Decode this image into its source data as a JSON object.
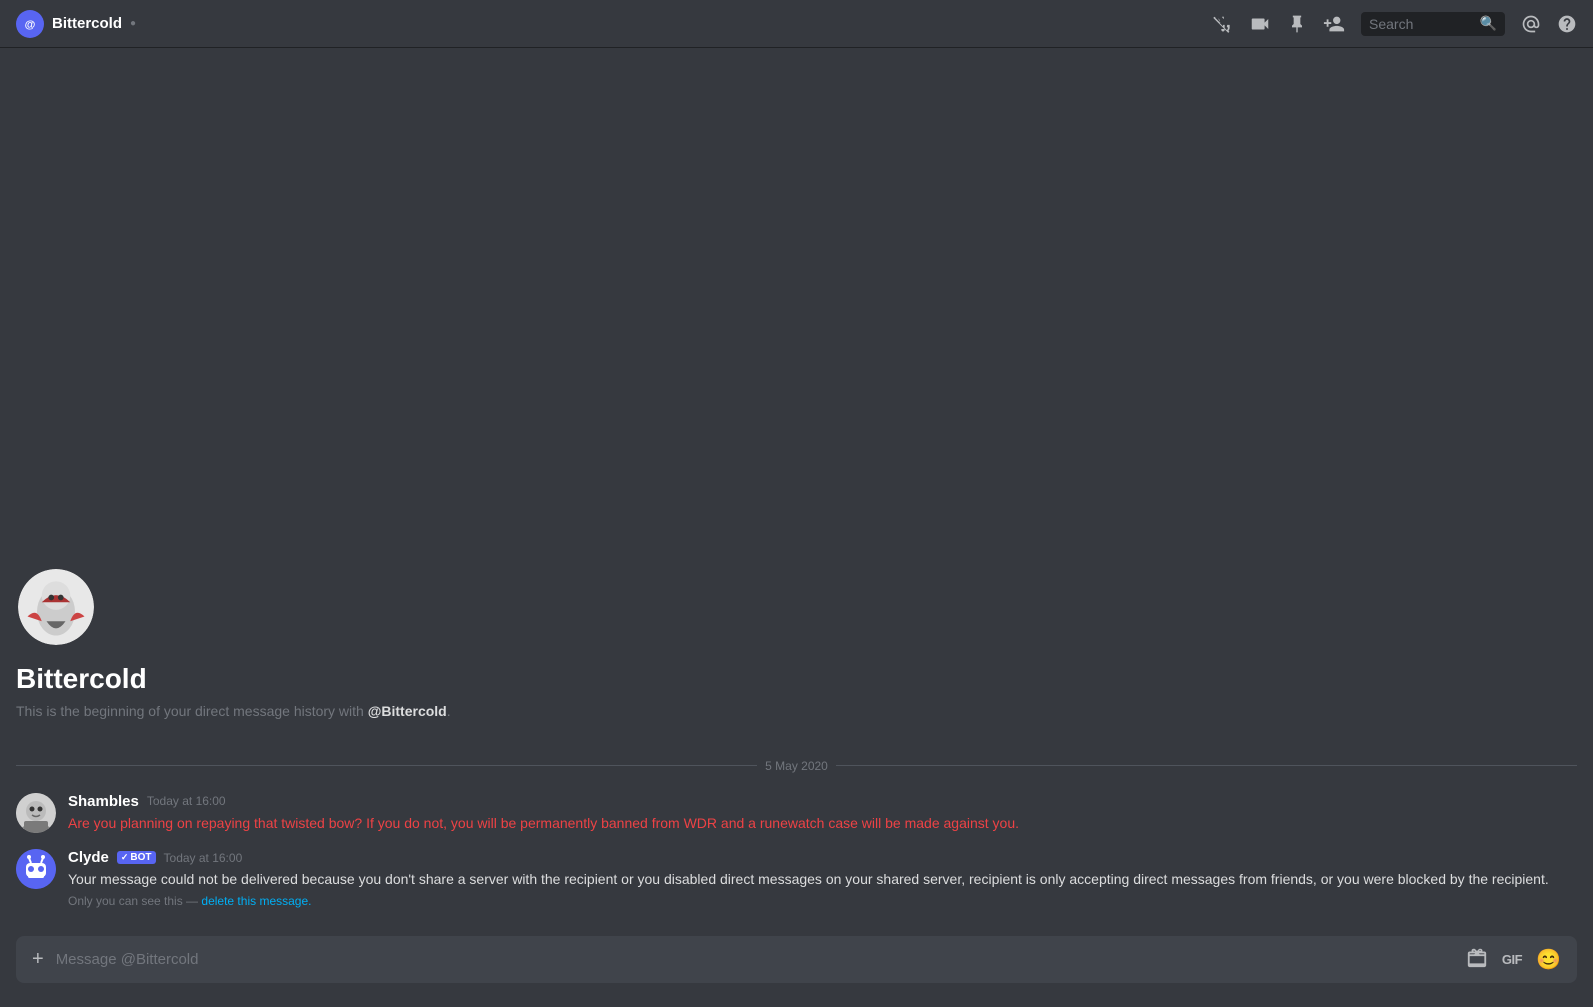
{
  "header": {
    "title": "Bittercold",
    "status_icon": "⚙",
    "actions": {
      "mute_label": "Mute",
      "video_label": "Video",
      "pin_label": "Pinned Messages",
      "add_friend_label": "Add Friend to DM",
      "search_placeholder": "Search",
      "mention_label": "Recent Mentions",
      "help_label": "Help"
    }
  },
  "chat": {
    "intro": {
      "name": "Bittercold",
      "description_prefix": "This is the beginning of your direct message history with ",
      "mention": "@Bittercold",
      "description_suffix": "."
    },
    "date_separator": "5 May 2020",
    "messages": [
      {
        "id": "msg-1",
        "author": "Shambles",
        "timestamp": "Today at 16:00",
        "text": "Are you planning on repaying that twisted bow? If you do not, you will be permanently banned from WDR and a runewatch case will be made against you.",
        "is_warning": true,
        "is_bot": false,
        "avatar_type": "shambles"
      },
      {
        "id": "msg-2",
        "author": "Clyde",
        "timestamp": "Today at 16:00",
        "text": "Your message could not be delivered because you don't share a server with the recipient or you disabled direct messages on your shared server, recipient is only accepting direct messages from friends, or you were blocked by the recipient.",
        "is_warning": false,
        "is_bot": true,
        "avatar_type": "clyde",
        "only_you_prefix": "Only you can see this — ",
        "delete_link_text": "delete this message."
      }
    ]
  },
  "input": {
    "placeholder": "Message @Bittercold",
    "add_label": "+",
    "gif_label": "GIF",
    "emoji_label": "😊"
  }
}
